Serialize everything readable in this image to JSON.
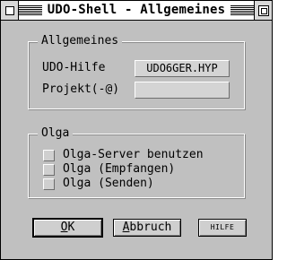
{
  "window": {
    "title": "UDO-Shell - Allgemeines"
  },
  "allgemeines": {
    "heading": "Allgemeines",
    "udo_hilfe_label": "UDO-Hilfe",
    "udo_hilfe_value": "UDO6GER.HYP",
    "projekt_label": "Projekt(-@)",
    "projekt_value": ""
  },
  "olga": {
    "heading": "Olga",
    "options": [
      {
        "label": "Olga-Server benutzen",
        "checked": false
      },
      {
        "label": "Olga (Empfangen)",
        "checked": false
      },
      {
        "label": "Olga (Senden)",
        "checked": false
      }
    ]
  },
  "buttons": {
    "ok_first": "O",
    "ok_rest": "K",
    "abbruch_first": "A",
    "abbruch_rest": "bbruch",
    "hilfe": "HILFE"
  }
}
